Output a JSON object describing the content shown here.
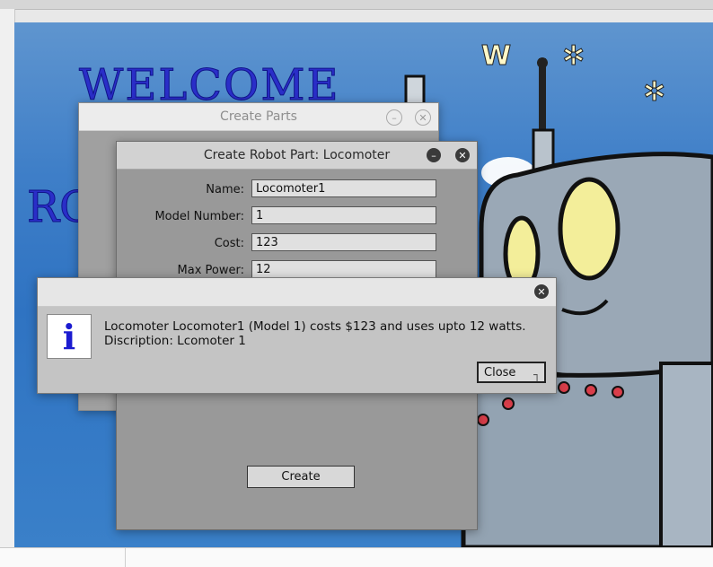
{
  "background": {
    "welcome_text": "WELCOME",
    "partial_text": "RO"
  },
  "create_parts_window": {
    "title": "Create Parts"
  },
  "locomoter_window": {
    "title": "Create Robot Part: Locomoter",
    "fields": [
      {
        "label": "Name:",
        "value": "Locomoter1"
      },
      {
        "label": "Model Number:",
        "value": "1"
      },
      {
        "label": "Cost:",
        "value": "123"
      },
      {
        "label": "Max Power:",
        "value": "12"
      }
    ],
    "create_button": "Create"
  },
  "message_dialog": {
    "icon": "i",
    "line1": "Locomoter Locomoter1 (Model 1) costs $123 and uses upto 12 watts.",
    "line2": "Discription: Lcomoter 1",
    "close_button": "Close"
  },
  "colors": {
    "sky": "#3f7fc8",
    "welcome": "#2a2ec8",
    "dialog": "#c4c4c4"
  }
}
